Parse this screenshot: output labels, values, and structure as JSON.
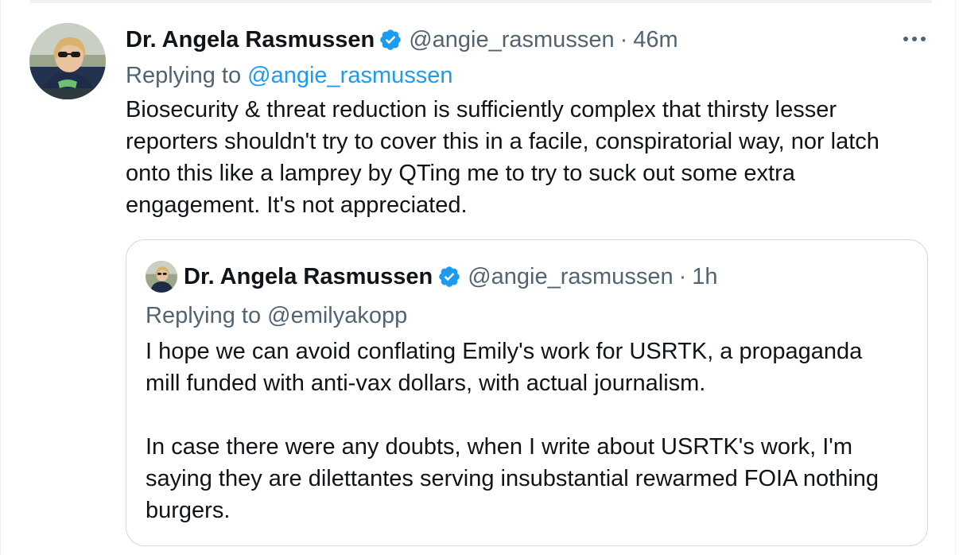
{
  "tweet": {
    "author_name": "Dr. Angela Rasmussen",
    "handle": "@angie_rasmussen",
    "separator": "·",
    "time": "46m",
    "replying_prefix": "Replying to",
    "replying_to": "@angie_rasmussen",
    "text": "Biosecurity & threat reduction is sufficiently complex that thirsty lesser\nreporters shouldn't try to cover this in a facile, conspiratorial way, nor latch\nonto this like a lamprey by QTing me to try to suck out some extra\nengagement. It's not appreciated.",
    "more_icon": "more-horizontal-icon",
    "verified_icon": "verified-badge-icon"
  },
  "quoted_tweet": {
    "author_name": "Dr. Angela Rasmussen",
    "handle": "@angie_rasmussen",
    "separator": "·",
    "time": "1h",
    "replying_line": "Replying to @emilyakopp",
    "text": "I hope we can avoid conflating Emily's work for USRTK, a propaganda\nmill funded with anti-vax dollars, with actual journalism.\n\nIn case there were any doubts, when I write about USRTK's work, I'm\nsaying they are dilettantes serving insubstantial rewarmed FOIA nothing\nburgers."
  },
  "colors": {
    "text": "#0f1419",
    "secondary": "#536471",
    "link": "#1d9bf0",
    "verified": "#1d9bf0",
    "border": "#cfd9de"
  }
}
